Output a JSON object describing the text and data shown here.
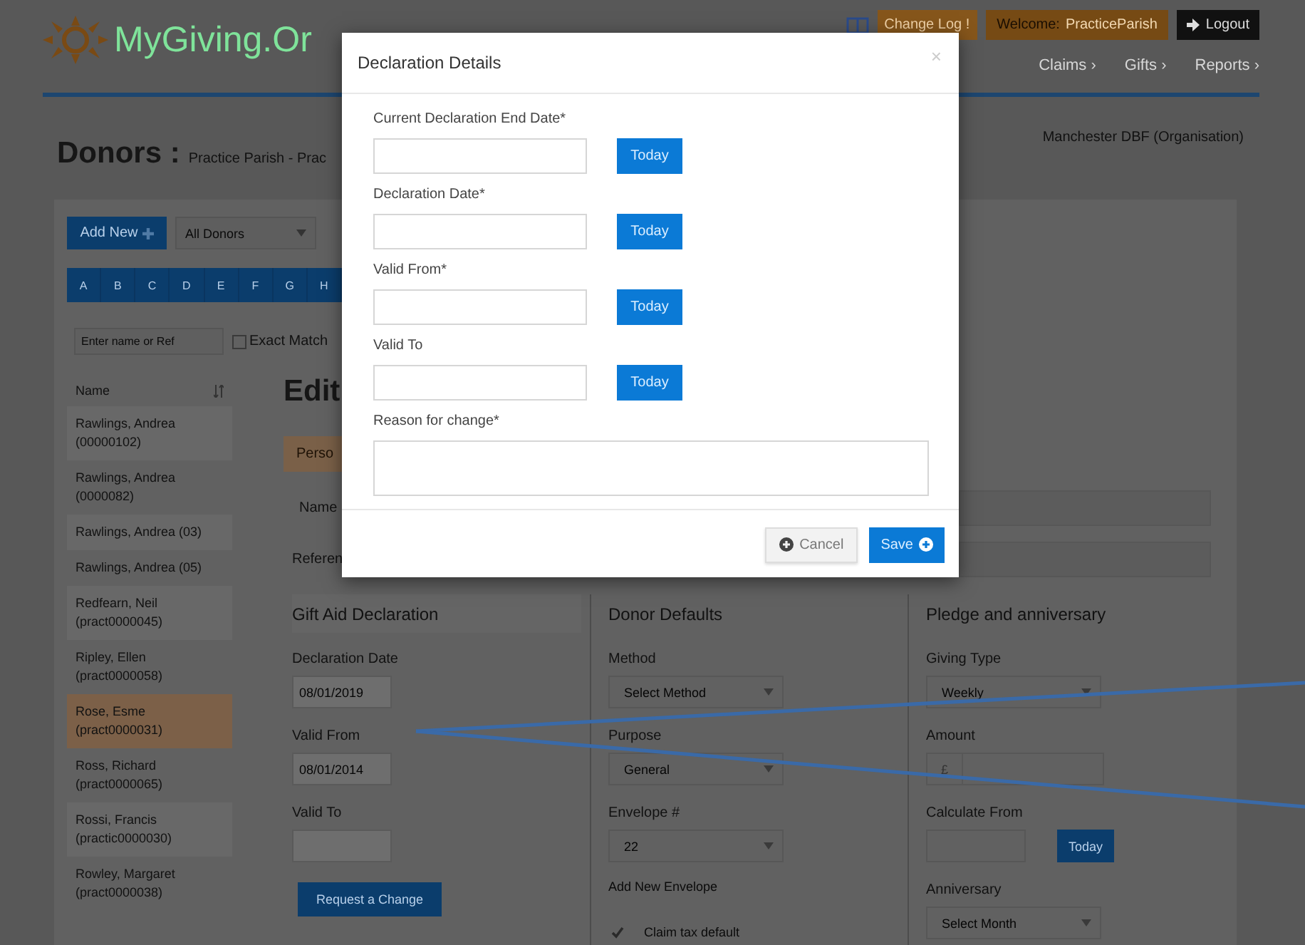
{
  "header": {
    "logo": "MyGiving.Or",
    "change_log": "Change Log !",
    "welcome_label": "Welcome:",
    "welcome_user": "PracticeParish",
    "logout": "Logout",
    "nav": [
      "Claims ›",
      "Gifts ›",
      "Reports ›"
    ]
  },
  "page": {
    "title": "Donors :",
    "subtitle": "Practice Parish - Prac",
    "organisation": "Manchester DBF (Organisation)"
  },
  "toolbar": {
    "add_new": "Add New",
    "donor_filter": "All Donors",
    "letters": [
      "A",
      "B",
      "C",
      "D",
      "E",
      "F",
      "G",
      "H"
    ],
    "search": {
      "placeholder": "Enter name or Ref"
    },
    "exact_match": {
      "label": "Exact Match",
      "checked": false
    }
  },
  "donor_list": {
    "header": "Name",
    "items": [
      {
        "name": "Rawlings, Andrea",
        "ref": "(00000102)",
        "selected": false
      },
      {
        "name": "Rawlings, Andrea",
        "ref": "(0000082)",
        "selected": false
      },
      {
        "name": "Rawlings, Andrea (03)",
        "selected": false
      },
      {
        "name": "Rawlings, Andrea (05)",
        "selected": false
      },
      {
        "name": "Redfearn, Neil",
        "ref": "(pract0000045)",
        "selected": false
      },
      {
        "name": "Ripley, Ellen",
        "ref": "(pract0000058)",
        "selected": false
      },
      {
        "name": "Rose, Esme",
        "ref": "(pract0000031)",
        "selected": true
      },
      {
        "name": "Ross, Richard",
        "ref": "(pract0000065)",
        "selected": false
      },
      {
        "name": "Rossi, Francis",
        "ref": "(practic0000030)",
        "selected": false
      },
      {
        "name": "Rowley, Margaret",
        "ref": "(pract0000038)",
        "selected": false
      }
    ]
  },
  "edit": {
    "title": "Edit",
    "tab": "Perso",
    "name_label": "Name",
    "reference_label": "Referen"
  },
  "sections": [
    {
      "title": "Gift Aid Declaration",
      "fields": [
        {
          "kind": "text",
          "label": "Declaration Date",
          "value": "08/01/2019"
        },
        {
          "kind": "text",
          "label": "Valid From",
          "value": "08/01/2014"
        },
        {
          "kind": "text",
          "label": "Valid To"
        }
      ],
      "button": "Request a Change"
    },
    {
      "title": "Donor Defaults",
      "fields": [
        {
          "kind": "select",
          "label": "Method",
          "value": "Select Method"
        },
        {
          "kind": "select",
          "label": "Purpose",
          "value": "General"
        },
        {
          "kind": "select",
          "label": "Envelope #",
          "value": "22"
        }
      ],
      "link": "Add New Envelope",
      "checkbox": {
        "label": "Claim tax default",
        "checked": true
      }
    },
    {
      "title": "Pledge and anniversary",
      "fields": [
        {
          "kind": "select",
          "label": "Giving Type",
          "value": "Weekly"
        },
        {
          "kind": "currency",
          "label": "Amount",
          "prefix": "£"
        },
        {
          "kind": "date",
          "label": "Calculate From",
          "button": "Today"
        },
        {
          "kind": "select",
          "label": "Anniversary",
          "value": "Select Month"
        }
      ]
    }
  ],
  "modal": {
    "title": "Declaration Details",
    "close": "×",
    "fields": [
      {
        "kind": "date",
        "label": "Current Declaration End Date*",
        "button": "Today"
      },
      {
        "kind": "date",
        "label": "Declaration Date*",
        "button": "Today"
      },
      {
        "kind": "date",
        "label": "Valid From*",
        "button": "Today"
      },
      {
        "kind": "date",
        "label": "Valid To",
        "button": "Today"
      },
      {
        "kind": "textarea",
        "label": "Reason for change*"
      }
    ],
    "cancel": "Cancel",
    "save": "Save"
  }
}
